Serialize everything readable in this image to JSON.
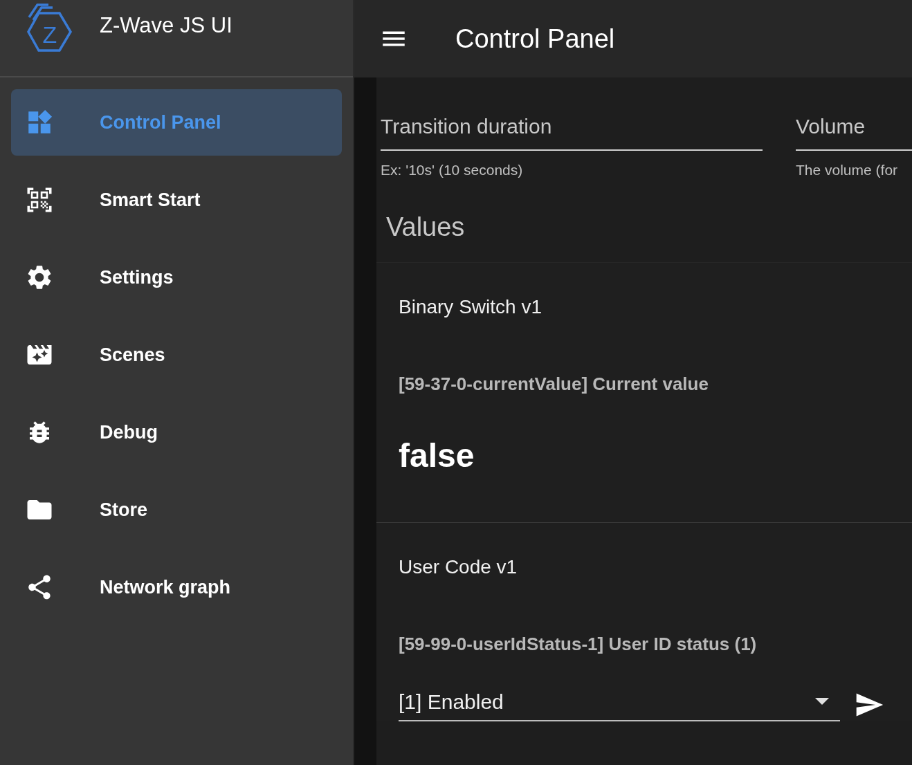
{
  "sidebar": {
    "logo_letter": "Z",
    "title": "Z-Wave JS UI",
    "items": [
      {
        "label": "Control Panel",
        "selected": true
      },
      {
        "label": "Smart Start",
        "selected": false
      },
      {
        "label": "Settings",
        "selected": false
      },
      {
        "label": "Scenes",
        "selected": false
      },
      {
        "label": "Debug",
        "selected": false
      },
      {
        "label": "Store",
        "selected": false
      },
      {
        "label": "Network graph",
        "selected": false
      }
    ]
  },
  "app_bar": {
    "title": "Control Panel"
  },
  "fields": [
    {
      "label": "Transition duration",
      "hint": "Ex: '10s' (10 seconds)"
    },
    {
      "label": "Volume",
      "hint": "The volume (for"
    }
  ],
  "section_title": "Values",
  "cards": [
    {
      "kind": "readonly",
      "title": "Binary Switch v1",
      "value_label": "[59-37-0-currentValue] Current value",
      "value": "false"
    },
    {
      "kind": "select",
      "title": "User Code v1",
      "value_label": "[59-99-0-userIdStatus-1] User ID status (1)",
      "value": "[1] Enabled"
    }
  ]
}
